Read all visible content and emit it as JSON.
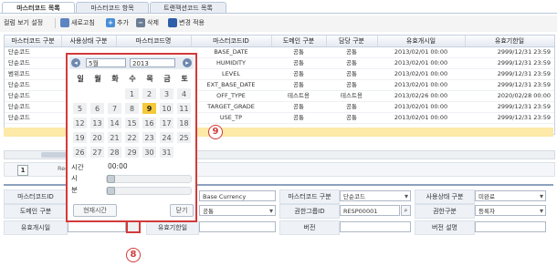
{
  "tabs": [
    "마스터코드 목록",
    "마스터코드 항목",
    "트랜잭션코드 목록"
  ],
  "toolbar": {
    "view_settings": "컬럼 보기 설정",
    "refresh": "새로고침",
    "add": "추가",
    "delete": "삭제",
    "apply_changes": "변경 적용"
  },
  "grid": {
    "headers": [
      "마스터코드 구분",
      "사용상태 구분",
      "마스터코드명",
      "마스터코드ID",
      "도메인 구분",
      "담당 구분",
      "유효개시일",
      "유효기한일"
    ],
    "rows": [
      {
        "kind": "단순코드",
        "code_id": "BASE_DATE",
        "domain": "공통",
        "owner": "공통",
        "start": "2013/02/01 00:00",
        "end": "2999/12/31 23:59"
      },
      {
        "kind": "단순코드",
        "code_id": "HUMIDITY",
        "domain": "공통",
        "owner": "공통",
        "start": "2013/02/01 00:00",
        "end": "2999/12/31 23:59"
      },
      {
        "kind": "범위코드",
        "code_id": "LEVEL",
        "domain": "공통",
        "owner": "공통",
        "start": "2013/02/01 00:00",
        "end": "2999/12/31 23:59"
      },
      {
        "kind": "단순코드",
        "code_id": "EXT_BASE_DATE",
        "domain": "공통",
        "owner": "공통",
        "start": "2013/02/01 00:00",
        "end": "2999/12/31 23:59"
      },
      {
        "kind": "단순코드",
        "code_id": "OFF_TYPE",
        "domain": "테스트용",
        "owner": "테스트용",
        "start": "2013/02/26 00:00",
        "end": "2020/02/28 00:00"
      },
      {
        "kind": "단순코드",
        "code_id": "TARGET_GRADE",
        "domain": "공통",
        "owner": "공통",
        "start": "2013/02/01 00:00",
        "end": "2999/12/31 23:59"
      },
      {
        "kind": "단순코드",
        "code_id": "USE_TP",
        "domain": "공통",
        "owner": "공통",
        "start": "2013/02/01 00:00",
        "end": "2999/12/31 23:59"
      }
    ]
  },
  "pager": {
    "page": "1",
    "info": "Rec"
  },
  "form": {
    "master_code_id_label": "마스터코드ID",
    "master_code_name_value": "Base Currency",
    "master_code_kind_label": "마스터코드 구분",
    "master_code_kind_value": "단순코드",
    "use_status_label": "사용상태 구분",
    "use_status_value": "미완료",
    "domain_label": "도메인 구분",
    "domain_value": "공통",
    "auth_group_label": "권한그룹ID",
    "auth_group_value": "RESP00001",
    "auth_kind_label": "권한구분",
    "auth_kind_value": "등록자",
    "valid_start_label": "유효개시일",
    "valid_end_label": "유효기한일",
    "version_label": "버전",
    "version_desc_label": "버전 설명"
  },
  "calendar": {
    "month": "5월",
    "year": "2013",
    "weekdays": [
      "일",
      "월",
      "화",
      "수",
      "목",
      "금",
      "토"
    ],
    "days": [
      "1",
      "2",
      "3",
      "4",
      "5",
      "6",
      "7",
      "8",
      "9",
      "10",
      "11",
      "12",
      "13",
      "14",
      "15",
      "16",
      "17",
      "18",
      "19",
      "20",
      "21",
      "22",
      "23",
      "24",
      "25",
      "26",
      "27",
      "28",
      "29",
      "30",
      "31"
    ],
    "selected_day": "9",
    "time_label": "시간",
    "time_value": "00:00",
    "hour_label": "시",
    "minute_label": "분",
    "now_button": "현재시간",
    "close_button": "닫기"
  },
  "markers": {
    "calendar": "9",
    "picker": "8"
  },
  "colors": {
    "accent_red": "#d23a3a",
    "selected_day": "#f5c938",
    "highlight_row": "#fde9a8"
  }
}
